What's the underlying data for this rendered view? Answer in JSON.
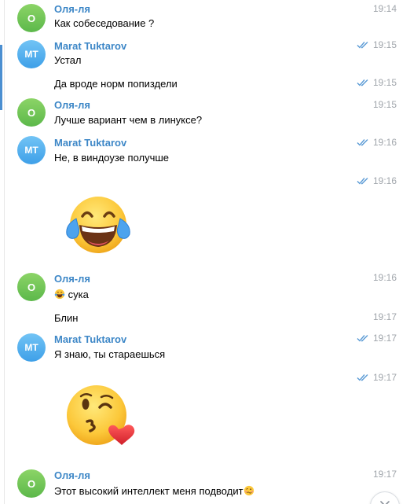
{
  "messages": [
    {
      "sender": "Оля-ля",
      "avatar": "О",
      "text": "Как собеседование ?",
      "time": "19:14"
    },
    {
      "sender": "Marat Tuktarov",
      "avatar": "MT",
      "text": "Устал",
      "time": "19:15"
    },
    {
      "text": "Да вроде норм попиздели",
      "time": "19:15"
    },
    {
      "sender": "Оля-ля",
      "avatar": "О",
      "text": "Лучше вариант чем в линуксе?",
      "time": "19:15"
    },
    {
      "sender": "Marat Tuktarov",
      "avatar": "MT",
      "text": "Не, в виндоузе получше",
      "time": "19:16"
    },
    {
      "sticker": "tears-of-joy-emoji",
      "time": "19:16"
    },
    {
      "sender": "Оля-ля",
      "avatar": "О",
      "text": "сука",
      "emoji": "tears-of-joy-emoji",
      "time": "19:16"
    },
    {
      "text": "Блин",
      "time": "19:17"
    },
    {
      "sender": "Marat Tuktarov",
      "avatar": "MT",
      "text": "Я знаю, ты стараешься",
      "time": "19:17"
    },
    {
      "sticker": "face-blowing-kiss-emoji",
      "time": "19:17"
    },
    {
      "sender": "Оля-ля",
      "avatar": "О",
      "text": "Этот высокий интеллект меня подводит",
      "emoji": "woozy-face-emoji",
      "time": "19:17"
    }
  ],
  "colors": {
    "sender_name": "#3d87c7",
    "time": "#a0a5ab",
    "read_check": "#5b9bd5",
    "avatar_green": "#6cc257",
    "avatar_blue": "#4aa8ec",
    "selection_indicator": "#4b8fd1"
  },
  "icons": {
    "read_status": "double-check-icon",
    "scroll_down": "chevron-down-icon"
  }
}
